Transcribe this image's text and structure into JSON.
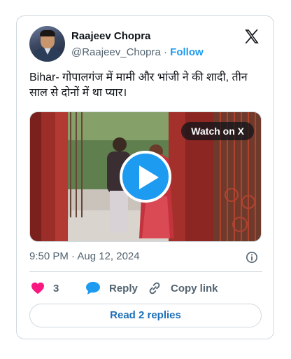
{
  "author": {
    "name": "Raajeev Chopra",
    "handle": "@Raajeev_Chopra",
    "separator": "·",
    "follow_label": "Follow"
  },
  "tweet": {
    "text": "Bihar- गोपालगंज में मामी और भांजी ने की शादी, तीन साल से दोनों में था प्यार।",
    "timestamp": "9:50 PM · Aug 12, 2024"
  },
  "media": {
    "watch_label": "Watch on X"
  },
  "actions": {
    "like_count": "3",
    "reply_label": "Reply",
    "copy_link_label": "Copy link"
  },
  "replies_button": "Read 2 replies",
  "colors": {
    "accent": "#1d9bf0",
    "like": "#f91880",
    "text": "#0f1419",
    "muted": "#536471",
    "border": "#cfd9de"
  }
}
